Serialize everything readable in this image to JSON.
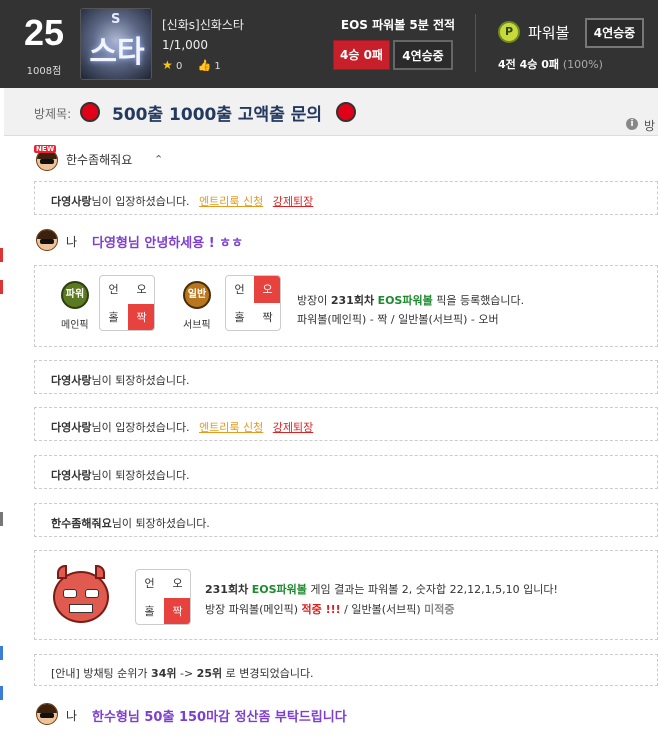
{
  "header": {
    "rank": "25",
    "points": "1008점",
    "avatar_text": "스타",
    "avatar_letter": "S",
    "room_owner": "[신화s]신화스타",
    "members": "1/1,000",
    "stars": "0",
    "likes": "1",
    "game_title": "EOS 파워볼 5분 전적",
    "record": "4승 0패",
    "streak": "4연승중",
    "powerball_icon": "P",
    "powerball_label": "파워볼",
    "powerball_streak": "4연승중",
    "powerball_record_main": "4전 4승 0패",
    "powerball_record_pct": "(100%)"
  },
  "title_bar": {
    "label": "방제목:",
    "title": "500출 1000출 고액출 문의",
    "sort_label": "방"
  },
  "chat": {
    "top_user": {
      "new_tag": "NEW",
      "nickname": "한수좀해줘요",
      "caret": "⌃"
    },
    "notice_enter_1": {
      "user": "다영사랑",
      "text": "님이 입장하셨습니다.",
      "link_entry": "엔트리룩 신청",
      "link_kick": "강제퇴장"
    },
    "me_1": {
      "label": "나",
      "message": "다영형님 안녕하세용 ! ㅎㅎ"
    },
    "pick_card": {
      "main_badge": "파워볼",
      "main_caption": "메인픽",
      "main_grid": [
        "언",
        "오",
        "홀",
        "짝"
      ],
      "sub_badge": "일반볼",
      "sub_caption": "서브픽",
      "sub_grid": [
        "언",
        "오",
        "홀",
        "짝"
      ],
      "line1_pre": "방장이 ",
      "line1_round": "231회차",
      "line1_game": "EOS파워볼",
      "line1_post": " 픽을 등록했습니다.",
      "line2": "파워볼(메인픽) - 짝 / 일반볼(서브픽) - 오버"
    },
    "notice_exit_1": {
      "user": "다영사랑",
      "text": "님이 퇴장하셨습니다."
    },
    "notice_enter_2": {
      "user": "다영사랑",
      "text": "님이 입장하셨습니다.",
      "link_entry": "엔트리룩 신청",
      "link_kick": "강제퇴장"
    },
    "notice_exit_2": {
      "user": "다영사랑",
      "text": "님이 퇴장하셨습니다."
    },
    "notice_exit_3": {
      "user": "한수좀해줘요",
      "text": "님이 퇴장하셨습니다."
    },
    "result_card": {
      "grid": [
        "언",
        "오",
        "홀",
        "짝"
      ],
      "line1_round": "231회차",
      "line1_game": "EOS파워볼",
      "line1_post": " 게임 결과는 파워볼 2, 숫자합 22,12,1,5,10 입니다!",
      "line2_pre": "방장 파워볼(메인픽) ",
      "line2_hit": "적중 !!!",
      "line2_mid": " / 일반볼(서브픽) ",
      "line2_miss": "미적중"
    },
    "rank_notice": {
      "pre": "[안내] 방채팅 순위가 ",
      "from": "34위",
      "arrow": " -> ",
      "to": "25위",
      "post": " 로 변경되었습니다."
    },
    "me_2": {
      "label": "나",
      "message": "한수형님 50출 150마감 정산좀 부탁드립니다"
    }
  },
  "colors": {
    "accent_red": "#c8202a",
    "purple_msg": "#7d3fd0",
    "green_game": "#1d8a2d",
    "title_navy": "#24395f",
    "header_bg": "#333333"
  }
}
